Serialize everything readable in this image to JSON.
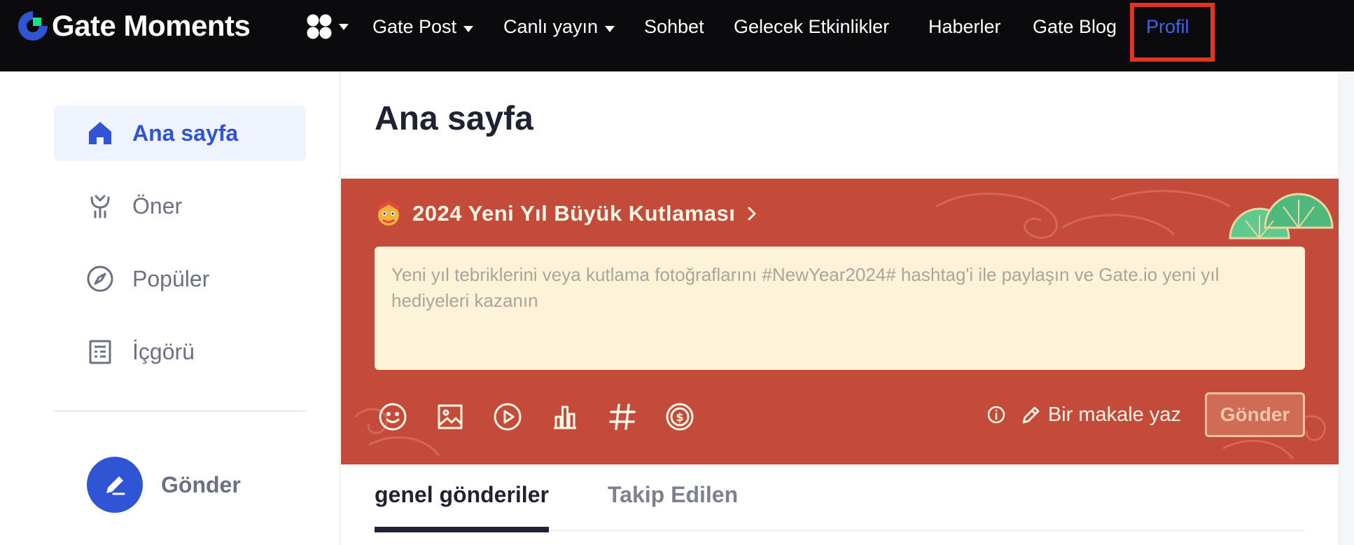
{
  "logo": {
    "text": "Gate Moments"
  },
  "nav": {
    "items": [
      {
        "label": "Gate Post",
        "dropdown": true
      },
      {
        "label": "Canlı yayın",
        "dropdown": true
      },
      {
        "label": "Sohbet",
        "dropdown": false
      },
      {
        "label": "Gelecek Etkinlikler",
        "dropdown": false
      },
      {
        "label": "Haberler",
        "dropdown": false
      },
      {
        "label": "Gate Blog",
        "dropdown": false
      },
      {
        "label": "Profil",
        "dropdown": false,
        "active": true,
        "highlighted": true
      }
    ]
  },
  "sidebar": {
    "items": [
      {
        "label": "Ana sayfa",
        "icon": "home-icon",
        "active": true
      },
      {
        "label": "Öner",
        "icon": "recommend-icon",
        "active": false
      },
      {
        "label": "Popüler",
        "icon": "compass-icon",
        "active": false
      },
      {
        "label": "İçgörü",
        "icon": "insight-icon",
        "active": false
      }
    ],
    "post_button": {
      "label": "Gönder",
      "icon": "pencil-icon"
    }
  },
  "main": {
    "page_title": "Ana sayfa",
    "banner": {
      "title": "2024 Yeni Yıl Büyük Kutlaması",
      "compose_placeholder": "Yeni yıl tebriklerini veya kutlama fotoğraflarını #NewYear2024# hashtag'i ile paylaşın ve Gate.io yeni yıl hediyeleri kazanın",
      "compose_value": "",
      "tools": [
        "emoji-icon",
        "image-icon",
        "video-icon",
        "chart-icon",
        "hashtag-icon",
        "coin-icon"
      ],
      "write_article": "Bir makale yaz",
      "send": "Gönder"
    },
    "tabs": [
      {
        "label": "genel gönderiler",
        "active": true
      },
      {
        "label": "Takip Edilen",
        "active": false
      }
    ]
  },
  "colors": {
    "nav_bg": "#0b0b0e",
    "accent_blue": "#2f55d4",
    "active_nav": "#3e63f3",
    "highlight_box": "#e1351f",
    "banner_red": "#c44a3a",
    "compose_bg": "#fdf3d8",
    "logo_green": "#17e08a"
  }
}
